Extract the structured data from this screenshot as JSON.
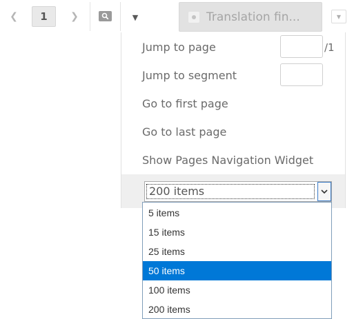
{
  "pagination": {
    "current_page": "1",
    "prev_icon": "chevron-left-icon",
    "next_icon": "chevron-right-icon"
  },
  "toolbar": {
    "search_icon": "search-icon",
    "menu_toggle_icon": "caret-down-icon",
    "translation_button_label": "Translation fin..."
  },
  "menu": {
    "jump_to_page_label": "Jump to page",
    "jump_to_page_value": "",
    "total_pages": "/1",
    "jump_to_segment_label": "Jump to segment",
    "jump_to_segment_value": "",
    "go_first_label": "Go to first page",
    "go_last_label": "Go to last page",
    "show_widget_label": "Show Pages Navigation Widget",
    "items_per_page_value": "200 items"
  },
  "items_options": [
    {
      "label": "5 items",
      "selected": false
    },
    {
      "label": "15 items",
      "selected": false
    },
    {
      "label": "25 items",
      "selected": false
    },
    {
      "label": "50 items",
      "selected": true
    },
    {
      "label": "100 items",
      "selected": false
    },
    {
      "label": "200 items",
      "selected": false
    }
  ],
  "colors": {
    "highlight": "#0078d7",
    "select_focus": "#3a7bc8"
  }
}
